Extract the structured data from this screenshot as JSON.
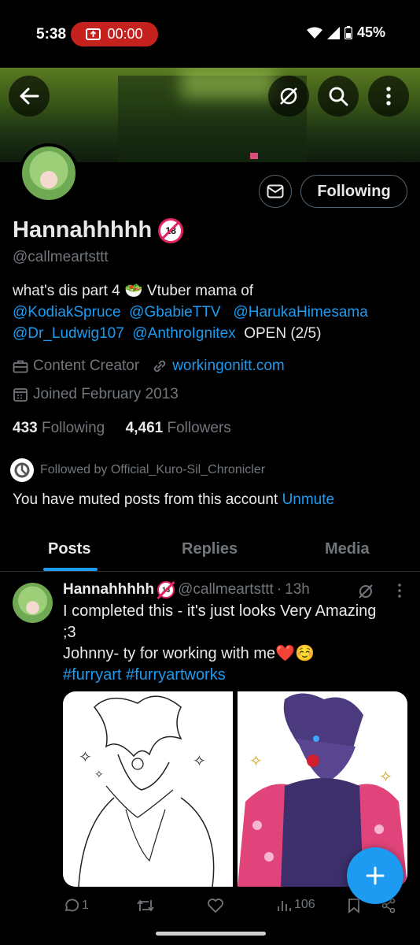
{
  "status_bar": {
    "time": "5:38",
    "recording": "00:00",
    "battery": "45%"
  },
  "header": {
    "icons": [
      "back-arrow-icon",
      "loop-icon",
      "search-icon",
      "more-vert-icon"
    ]
  },
  "profile": {
    "following_button": "Following",
    "name": "Hannahhhhh",
    "age_badge": "18",
    "handle": "@callmeartsttt",
    "bio": {
      "line1": "what's dis part 4 🥗 Vtuber mama of",
      "mentions_line2": [
        "@KodiakSpruce",
        "@GbabieTTV",
        "@HarukaHimesama"
      ],
      "mentions_line3": [
        "@Dr_Ludwig107",
        "@AnthroIgnitex"
      ],
      "status": "OPEN (2/5)"
    },
    "category": "Content Creator",
    "website": "workingonitt.com",
    "joined": "Joined February 2013",
    "following_count": "433",
    "following_label": "Following",
    "followers_count": "4,461",
    "followers_label": "Followers",
    "followed_by": "Followed by Official_Kuro-Sil_Chronicler",
    "muted_text": "You have muted posts from this account",
    "unmute_label": "Unmute"
  },
  "tabs": [
    {
      "label": "Posts",
      "active": true
    },
    {
      "label": "Replies",
      "active": false
    },
    {
      "label": "Media",
      "active": false
    }
  ],
  "post": {
    "name": "Hannahhhhh",
    "handle": "@callmeartsttt",
    "dot": "·",
    "time": "13h",
    "text_line1": "I completed this - it's just looks Very Amazing",
    "text_line2": ";3",
    "text_line3": "Johnny- ty for working with me❤️☺️",
    "hashtags": [
      "#furryart",
      "#furryartworks"
    ],
    "replies": "1",
    "views": "106"
  },
  "colors": {
    "accent": "#1d9bf0",
    "background": "#000000",
    "secondary_text": "#71767b",
    "recording_pill": "#c5221f"
  }
}
